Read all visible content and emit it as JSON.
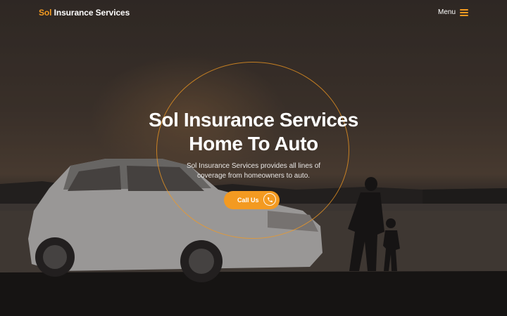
{
  "navbar": {
    "brand_accent": "Sol",
    "brand_rest": "Insurance Services",
    "menu_label": "Menu",
    "menu_icon": "hamburger-icon"
  },
  "hero": {
    "headline_line1": "Sol Insurance Services",
    "headline_line2": "Home To Auto",
    "subtext_line1": "Sol Insurance Services provides all lines of",
    "subtext_line2": "coverage from homeowners to auto.",
    "cta_label": "Call Us",
    "cta_icon": "phone-icon",
    "background_image": "silhouette of suv and parent with child by lake at sunset"
  },
  "colors": {
    "accent": "#f39a21",
    "text": "#ffffff"
  }
}
